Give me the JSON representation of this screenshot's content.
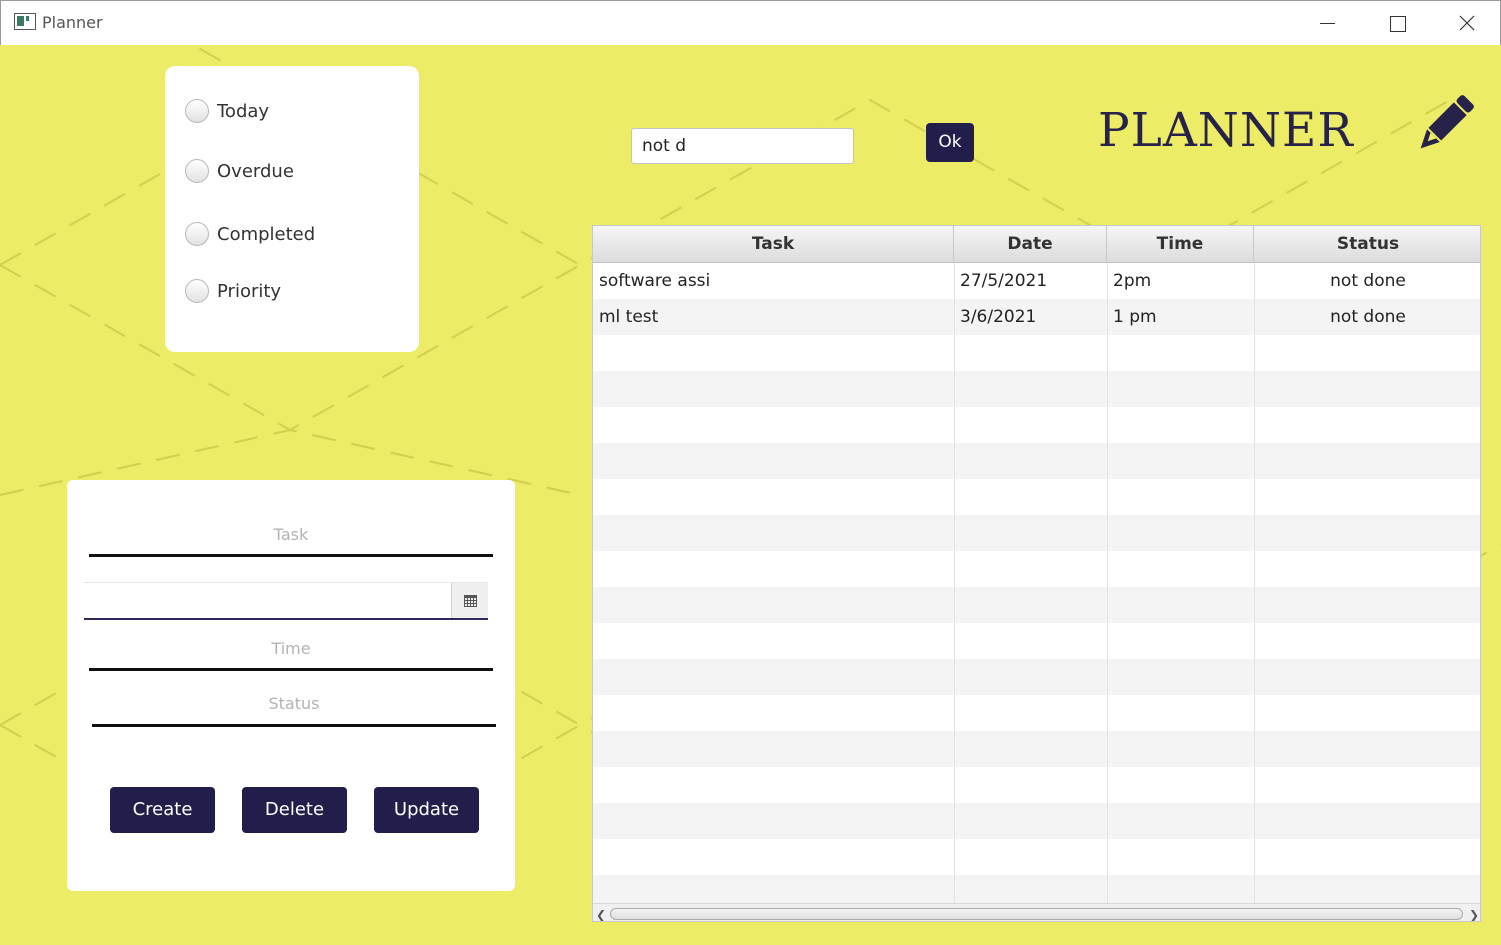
{
  "window": {
    "title": "Planner"
  },
  "filters": [
    {
      "label": "Today"
    },
    {
      "label": "Overdue"
    },
    {
      "label": "Completed"
    },
    {
      "label": "Priority"
    }
  ],
  "search": {
    "value": "not d",
    "button_label": "Ok"
  },
  "header": {
    "title": "PLANNER",
    "icon": "pencil-icon"
  },
  "form": {
    "task_placeholder": "Task",
    "date_value": "",
    "time_placeholder": "Time",
    "status_placeholder": "Status",
    "buttons": {
      "create": "Create",
      "delete": "Delete",
      "update": "Update"
    }
  },
  "table": {
    "columns": [
      "Task",
      "Date",
      "Time",
      "Status"
    ],
    "rows": [
      {
        "task": "software assi",
        "date": "27/5/2021",
        "time": "2pm",
        "status": "not done"
      },
      {
        "task": "ml test",
        "date": "3/6/2021",
        "time": "1 pm",
        "status": "not done"
      }
    ]
  },
  "colors": {
    "background": "#ecec66",
    "accent": "#221e4c"
  }
}
